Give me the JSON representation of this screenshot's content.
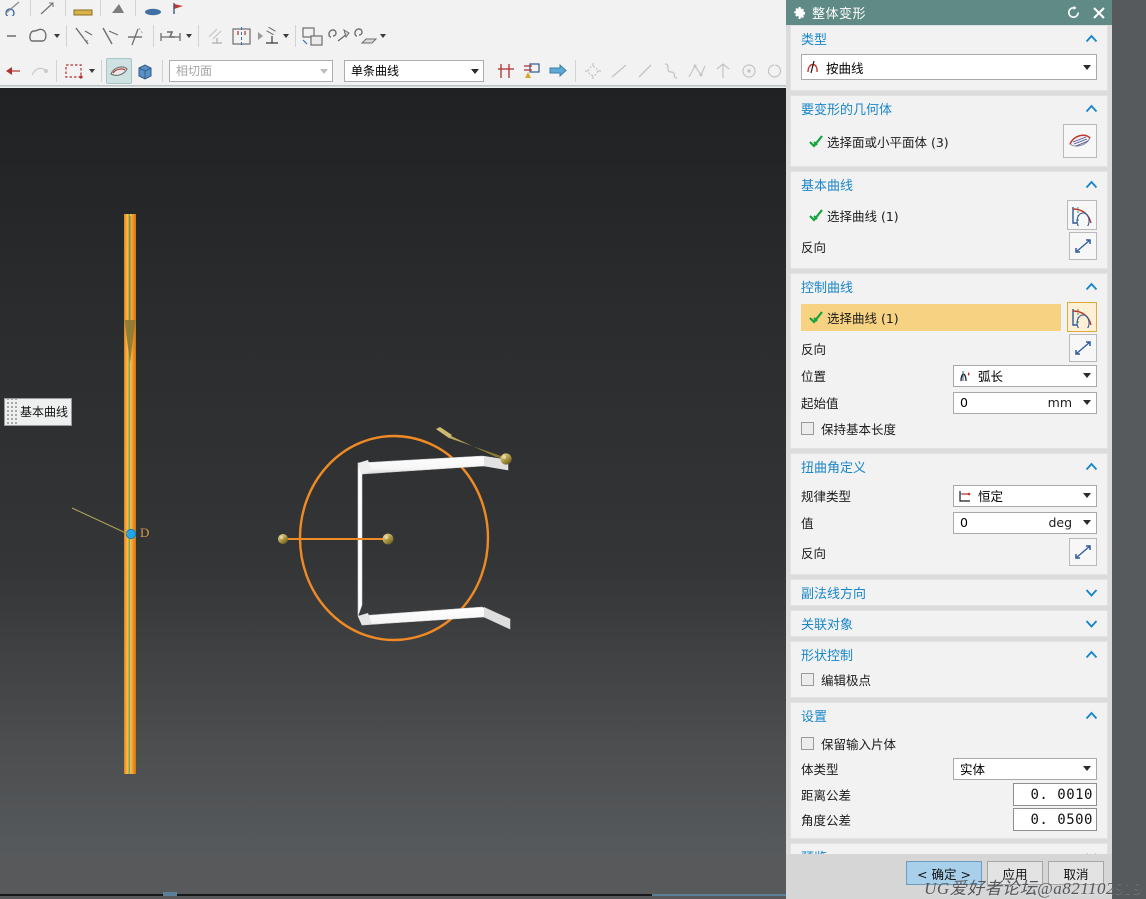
{
  "toolbar": {
    "row2": {
      "combo_tangent": {
        "value": "相切面",
        "enabled": false
      },
      "combo_curve": {
        "value": "单条曲线",
        "enabled": true
      }
    }
  },
  "viewport": {
    "callout_label": "基本曲线",
    "point_label": "D"
  },
  "dialog": {
    "title": "整体变形",
    "titlebar_icons": {
      "gear": "gear-icon",
      "reset": "reset-icon",
      "close": "close-icon"
    },
    "sections": [
      {
        "key": "type",
        "title": "类型",
        "expanded": true,
        "type_value": "按曲线"
      },
      {
        "key": "geometry",
        "title": "要变形的几何体",
        "expanded": true,
        "select_label": "选择面或小平面体 (3)"
      },
      {
        "key": "base_curve",
        "title": "基本曲线",
        "expanded": true,
        "select_label": "选择曲线 (1)",
        "reverse_label": "反向"
      },
      {
        "key": "control_curve",
        "title": "控制曲线",
        "expanded": true,
        "select_label": "选择曲线 (1)",
        "reverse_label": "反向",
        "position_label": "位置",
        "position_value": "弧长",
        "start_label": "起始值",
        "start_value": "0",
        "start_unit": "mm",
        "keep_length_label": "保持基本长度",
        "keep_length_checked": false
      },
      {
        "key": "twist",
        "title": "扭曲角定义",
        "expanded": true,
        "law_label": "规律类型",
        "law_value": "恒定",
        "value_label": "值",
        "value_value": "0",
        "value_unit": "deg",
        "reverse_label": "反向"
      },
      {
        "key": "binormal",
        "title": "副法线方向",
        "expanded": false
      },
      {
        "key": "associative",
        "title": "关联对象",
        "expanded": false
      },
      {
        "key": "shape_control",
        "title": "形状控制",
        "expanded": true,
        "edit_poles_label": "编辑极点",
        "edit_poles_checked": false
      },
      {
        "key": "settings",
        "title": "设置",
        "expanded": true,
        "keep_input_label": "保留输入片体",
        "keep_input_checked": false,
        "body_type_label": "体类型",
        "body_type_value": "实体",
        "dist_tol_label": "距离公差",
        "dist_tol_value": "0. 0010",
        "angle_tol_label": "角度公差",
        "angle_tol_value": "0. 0500"
      },
      {
        "key": "preview",
        "title": "预览",
        "expanded": false
      }
    ],
    "buttons": {
      "ok": "< 确定 >",
      "apply": "应用",
      "cancel": "取消"
    }
  },
  "watermark": "UG爱好者论坛@a821102919",
  "colors": {
    "titlebar": "#5f8a85",
    "section_heading": "#1a86c8",
    "highlight_row": "#f7d283",
    "primary_button": "#a8d0ea",
    "geometry_orange": "#f08a24",
    "solid_white": "#ffffff"
  }
}
